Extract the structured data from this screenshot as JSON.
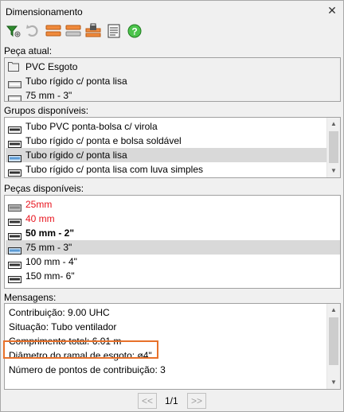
{
  "window": {
    "title": "Dimensionamento",
    "close_label": "✕"
  },
  "toolbar": [
    {
      "icon": "tree-filter-icon"
    },
    {
      "icon": "undo-icon"
    },
    {
      "icon": "pipe-orange-icon"
    },
    {
      "icon": "pipe-orange-gray-icon"
    },
    {
      "icon": "lock-pipe-icon"
    },
    {
      "icon": "report-icon"
    },
    {
      "icon": "help-icon"
    }
  ],
  "peca_atual": {
    "label": "Peça atual:",
    "items": [
      {
        "text": "PVC Esgoto",
        "icon": "folder-icon"
      },
      {
        "text": "Tubo rígido c/ ponta lisa",
        "icon": "pipe-icon"
      },
      {
        "text": "75 mm - 3\"",
        "icon": "pipe-icon"
      }
    ]
  },
  "grupos": {
    "label": "Grupos disponíveis:",
    "items": [
      {
        "text": "Tubo PVC ponta-bolsa c/ virola",
        "selected": false
      },
      {
        "text": "Tubo rígido c/ ponta e bolsa soldável",
        "selected": false
      },
      {
        "text": "Tubo rígido c/ ponta lisa",
        "selected": true
      },
      {
        "text": "Tubo rígido c/ ponta lisa com luva simples",
        "selected": false
      }
    ]
  },
  "pecas": {
    "label": "Peças disponíveis:",
    "items": [
      {
        "text": "25mm",
        "style": "red",
        "selected": false
      },
      {
        "text": "40 mm",
        "style": "red",
        "selected": false
      },
      {
        "text": "50 mm - 2\"",
        "style": "bold",
        "selected": false
      },
      {
        "text": "75 mm - 3\"",
        "style": "normal",
        "selected": true
      },
      {
        "text": "100 mm - 4\"",
        "style": "normal",
        "selected": false
      },
      {
        "text": "150 mm- 6\"",
        "style": "normal",
        "selected": false
      }
    ]
  },
  "mensagens": {
    "label": "Mensagens:",
    "lines": [
      "Contribuição: 9.00 UHC",
      "Situação: Tubo ventilador",
      "Comprimento total: 6.01 m",
      "Diâmetro do ramal de esgoto: ø4\"",
      "Número de pontos de contribuição: 3"
    ]
  },
  "pager": {
    "prev": "<<",
    "page": "1/1",
    "next": ">>"
  },
  "colors": {
    "selection": "#d9d9d9",
    "highlight": "#e8712a",
    "red_text": "#e8141e"
  }
}
